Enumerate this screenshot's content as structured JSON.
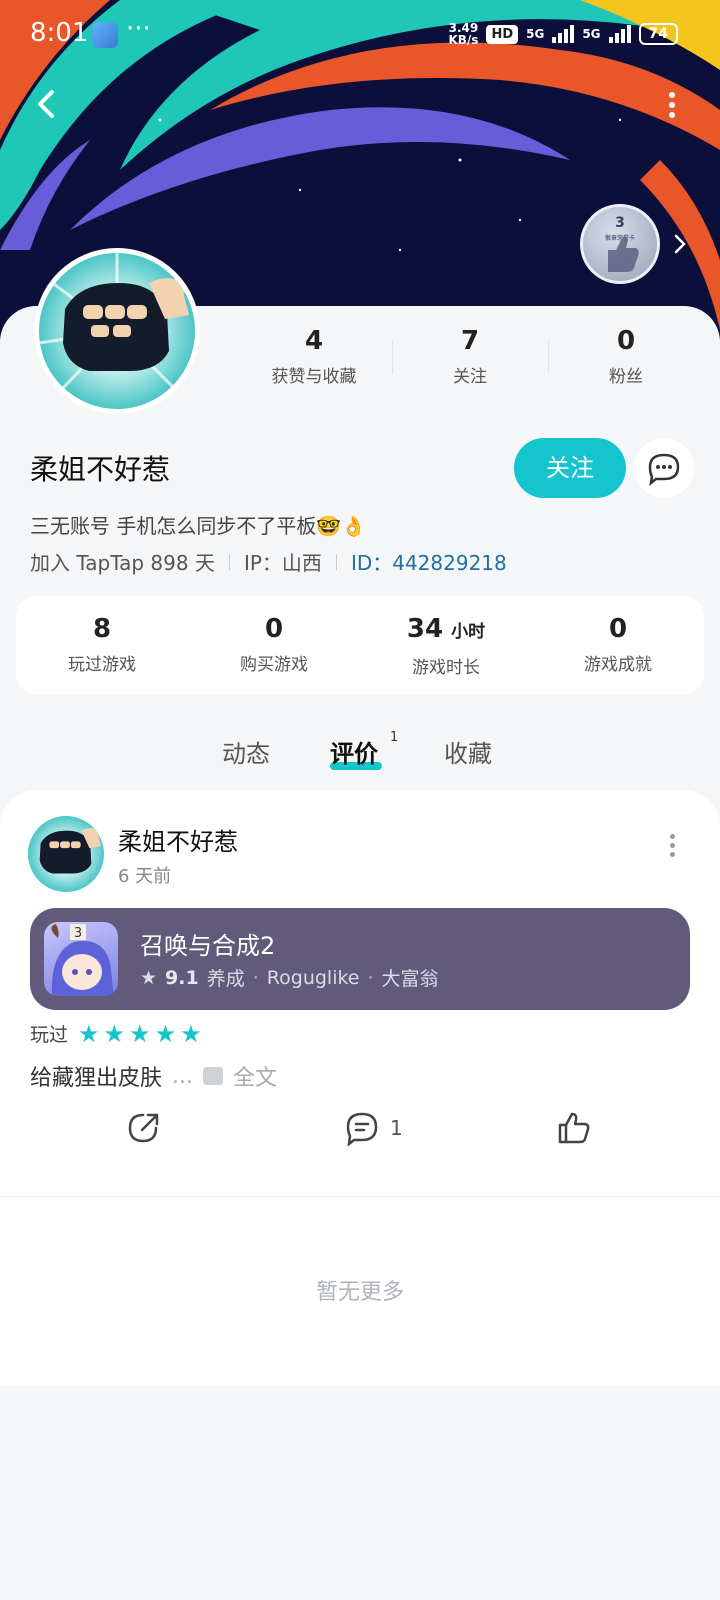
{
  "status_bar": {
    "time": "8:01",
    "dots": "···",
    "speed_value": "3.49",
    "speed_unit": "KB/s",
    "hd_label": "HD",
    "signal_1": "5G",
    "signal_2": "5G",
    "battery": "74"
  },
  "header": {
    "badge_level": "3",
    "badge_caption": "徽章荣誉卡"
  },
  "profile_stats": [
    {
      "value": "4",
      "label": "获赞与收藏"
    },
    {
      "value": "7",
      "label": "关注"
    },
    {
      "value": "0",
      "label": "粉丝"
    }
  ],
  "user": {
    "name": "柔姐不好惹",
    "follow_label": "关注",
    "bio": "三无账号 手机怎么同步不了平板🤓👌",
    "join_text": "加入 TapTap 898 天",
    "ip_text": "IP：山西",
    "id_text": "ID：442829218"
  },
  "game_stats": [
    {
      "value": "8",
      "unit": "",
      "label": "玩过游戏"
    },
    {
      "value": "0",
      "unit": "",
      "label": "购买游戏"
    },
    {
      "value": "34",
      "unit": "小时",
      "label": "游戏时长"
    },
    {
      "value": "0",
      "unit": "",
      "label": "游戏成就"
    }
  ],
  "tabs": [
    {
      "label": "动态"
    },
    {
      "label": "评价",
      "count": "1",
      "active": true
    },
    {
      "label": "收藏"
    }
  ],
  "review": {
    "author": "柔姐不好惹",
    "time": "6 天前",
    "game": {
      "title": "召唤与合成2",
      "rating": "9.1",
      "tags": [
        "养成",
        "Roguglike",
        "大富翁"
      ],
      "icon_badge": "3"
    },
    "played_label": "玩过",
    "stars": 5,
    "text": "给藏狸出皮肤",
    "ellipsis": "...",
    "full_text_label": "全文",
    "comment_count": "1"
  },
  "footer": {
    "no_more": "暂无更多"
  },
  "colors": {
    "accent": "#15c5ce",
    "game_card_bg": "#615a7a",
    "id_link": "#1f6fa0"
  }
}
